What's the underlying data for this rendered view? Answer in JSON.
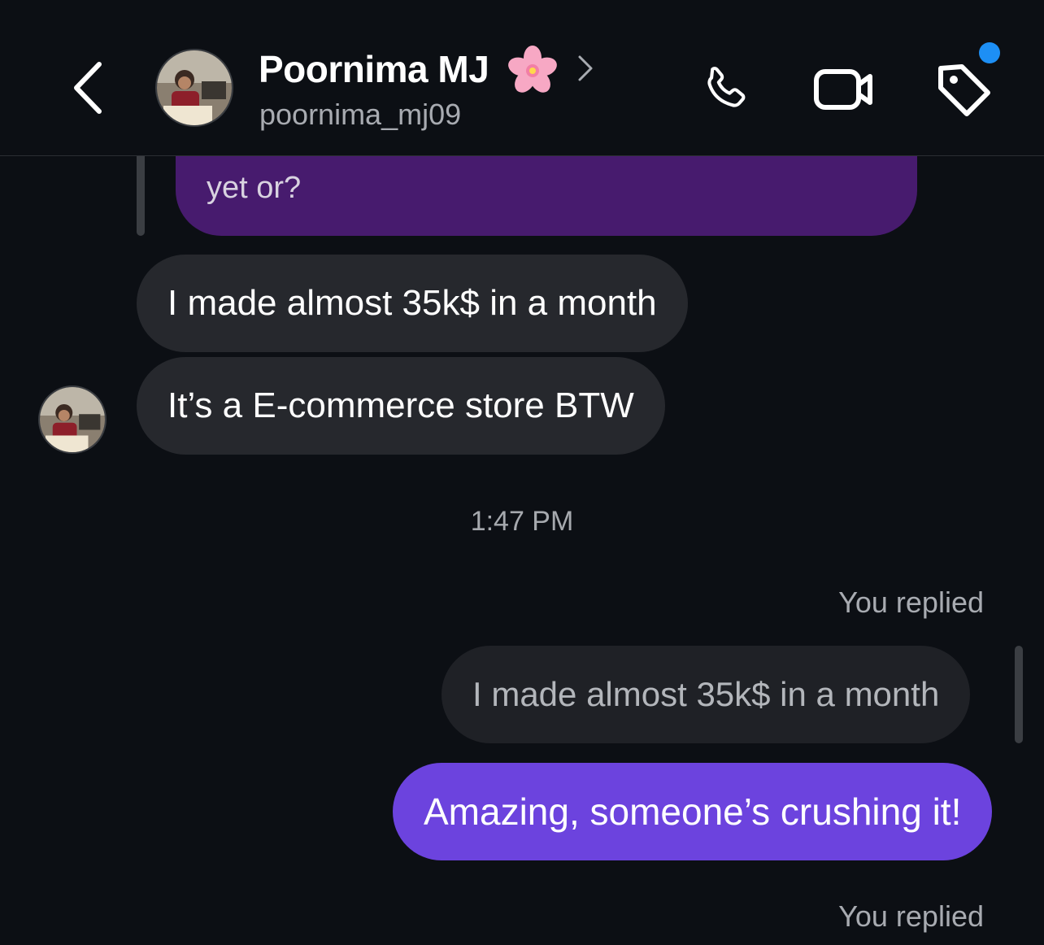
{
  "header": {
    "contact_name": "Poornima MJ",
    "name_emoji": "🌸",
    "username": "poornima_mj09",
    "icons": {
      "back": "chevron-left-icon",
      "chevron": "chevron-right-icon",
      "phone": "phone-icon",
      "video": "video-camera-icon",
      "tag": "tag-icon"
    },
    "notification_dot_color": "#1d8ff5"
  },
  "messages": {
    "quoted_outgoing_tail": "yet or?",
    "incoming": [
      {
        "text": "I made almost 35k$ in a month"
      },
      {
        "text": "It’s a E-commerce store BTW"
      }
    ],
    "timestamp": "1:47 PM",
    "reply_label_1": "You replied",
    "quoted_reply_text": "I made almost 35k$ in a month",
    "outgoing_reply": "Amazing, someone’s crushing it!",
    "reply_label_2": "You replied"
  },
  "colors": {
    "background": "#0c0f14",
    "incoming_bubble": "#26282d",
    "outgoing_bubble": "#6c43de",
    "quoted_outgoing_bubble": "#471b6e"
  }
}
